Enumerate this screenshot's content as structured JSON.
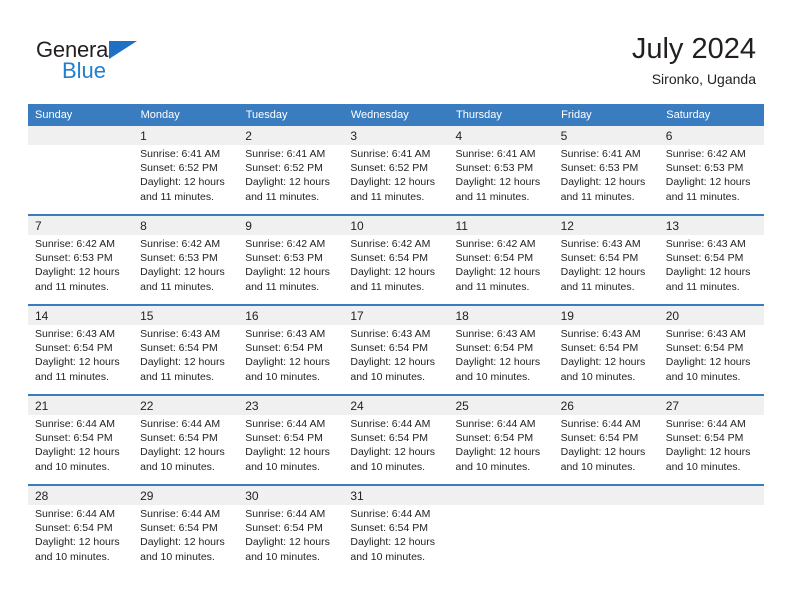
{
  "brand": {
    "name_part1": "General",
    "name_part2": "Blue",
    "accent_color": "#1f7fd0",
    "logo_triangle_color": "#1f6fc4"
  },
  "header": {
    "title": "July 2024",
    "subtitle": "Sironko, Uganda"
  },
  "theme": {
    "header_row_bg": "#3a7cc0",
    "header_row_text": "#ffffff",
    "daynum_row_bg": "#f0f0f0",
    "cell_text": "#231f20",
    "week_divider": "#3a7cc0"
  },
  "weekdays": [
    "Sunday",
    "Monday",
    "Tuesday",
    "Wednesday",
    "Thursday",
    "Friday",
    "Saturday"
  ],
  "weeks": [
    {
      "days": [
        {
          "num": "",
          "sunrise": "",
          "sunset": "",
          "daylight1": "",
          "daylight2": ""
        },
        {
          "num": "1",
          "sunrise": "Sunrise: 6:41 AM",
          "sunset": "Sunset: 6:52 PM",
          "daylight1": "Daylight: 12 hours",
          "daylight2": "and 11 minutes."
        },
        {
          "num": "2",
          "sunrise": "Sunrise: 6:41 AM",
          "sunset": "Sunset: 6:52 PM",
          "daylight1": "Daylight: 12 hours",
          "daylight2": "and 11 minutes."
        },
        {
          "num": "3",
          "sunrise": "Sunrise: 6:41 AM",
          "sunset": "Sunset: 6:52 PM",
          "daylight1": "Daylight: 12 hours",
          "daylight2": "and 11 minutes."
        },
        {
          "num": "4",
          "sunrise": "Sunrise: 6:41 AM",
          "sunset": "Sunset: 6:53 PM",
          "daylight1": "Daylight: 12 hours",
          "daylight2": "and 11 minutes."
        },
        {
          "num": "5",
          "sunrise": "Sunrise: 6:41 AM",
          "sunset": "Sunset: 6:53 PM",
          "daylight1": "Daylight: 12 hours",
          "daylight2": "and 11 minutes."
        },
        {
          "num": "6",
          "sunrise": "Sunrise: 6:42 AM",
          "sunset": "Sunset: 6:53 PM",
          "daylight1": "Daylight: 12 hours",
          "daylight2": "and 11 minutes."
        }
      ]
    },
    {
      "days": [
        {
          "num": "7",
          "sunrise": "Sunrise: 6:42 AM",
          "sunset": "Sunset: 6:53 PM",
          "daylight1": "Daylight: 12 hours",
          "daylight2": "and 11 minutes."
        },
        {
          "num": "8",
          "sunrise": "Sunrise: 6:42 AM",
          "sunset": "Sunset: 6:53 PM",
          "daylight1": "Daylight: 12 hours",
          "daylight2": "and 11 minutes."
        },
        {
          "num": "9",
          "sunrise": "Sunrise: 6:42 AM",
          "sunset": "Sunset: 6:53 PM",
          "daylight1": "Daylight: 12 hours",
          "daylight2": "and 11 minutes."
        },
        {
          "num": "10",
          "sunrise": "Sunrise: 6:42 AM",
          "sunset": "Sunset: 6:54 PM",
          "daylight1": "Daylight: 12 hours",
          "daylight2": "and 11 minutes."
        },
        {
          "num": "11",
          "sunrise": "Sunrise: 6:42 AM",
          "sunset": "Sunset: 6:54 PM",
          "daylight1": "Daylight: 12 hours",
          "daylight2": "and 11 minutes."
        },
        {
          "num": "12",
          "sunrise": "Sunrise: 6:43 AM",
          "sunset": "Sunset: 6:54 PM",
          "daylight1": "Daylight: 12 hours",
          "daylight2": "and 11 minutes."
        },
        {
          "num": "13",
          "sunrise": "Sunrise: 6:43 AM",
          "sunset": "Sunset: 6:54 PM",
          "daylight1": "Daylight: 12 hours",
          "daylight2": "and 11 minutes."
        }
      ]
    },
    {
      "days": [
        {
          "num": "14",
          "sunrise": "Sunrise: 6:43 AM",
          "sunset": "Sunset: 6:54 PM",
          "daylight1": "Daylight: 12 hours",
          "daylight2": "and 11 minutes."
        },
        {
          "num": "15",
          "sunrise": "Sunrise: 6:43 AM",
          "sunset": "Sunset: 6:54 PM",
          "daylight1": "Daylight: 12 hours",
          "daylight2": "and 11 minutes."
        },
        {
          "num": "16",
          "sunrise": "Sunrise: 6:43 AM",
          "sunset": "Sunset: 6:54 PM",
          "daylight1": "Daylight: 12 hours",
          "daylight2": "and 10 minutes."
        },
        {
          "num": "17",
          "sunrise": "Sunrise: 6:43 AM",
          "sunset": "Sunset: 6:54 PM",
          "daylight1": "Daylight: 12 hours",
          "daylight2": "and 10 minutes."
        },
        {
          "num": "18",
          "sunrise": "Sunrise: 6:43 AM",
          "sunset": "Sunset: 6:54 PM",
          "daylight1": "Daylight: 12 hours",
          "daylight2": "and 10 minutes."
        },
        {
          "num": "19",
          "sunrise": "Sunrise: 6:43 AM",
          "sunset": "Sunset: 6:54 PM",
          "daylight1": "Daylight: 12 hours",
          "daylight2": "and 10 minutes."
        },
        {
          "num": "20",
          "sunrise": "Sunrise: 6:43 AM",
          "sunset": "Sunset: 6:54 PM",
          "daylight1": "Daylight: 12 hours",
          "daylight2": "and 10 minutes."
        }
      ]
    },
    {
      "days": [
        {
          "num": "21",
          "sunrise": "Sunrise: 6:44 AM",
          "sunset": "Sunset: 6:54 PM",
          "daylight1": "Daylight: 12 hours",
          "daylight2": "and 10 minutes."
        },
        {
          "num": "22",
          "sunrise": "Sunrise: 6:44 AM",
          "sunset": "Sunset: 6:54 PM",
          "daylight1": "Daylight: 12 hours",
          "daylight2": "and 10 minutes."
        },
        {
          "num": "23",
          "sunrise": "Sunrise: 6:44 AM",
          "sunset": "Sunset: 6:54 PM",
          "daylight1": "Daylight: 12 hours",
          "daylight2": "and 10 minutes."
        },
        {
          "num": "24",
          "sunrise": "Sunrise: 6:44 AM",
          "sunset": "Sunset: 6:54 PM",
          "daylight1": "Daylight: 12 hours",
          "daylight2": "and 10 minutes."
        },
        {
          "num": "25",
          "sunrise": "Sunrise: 6:44 AM",
          "sunset": "Sunset: 6:54 PM",
          "daylight1": "Daylight: 12 hours",
          "daylight2": "and 10 minutes."
        },
        {
          "num": "26",
          "sunrise": "Sunrise: 6:44 AM",
          "sunset": "Sunset: 6:54 PM",
          "daylight1": "Daylight: 12 hours",
          "daylight2": "and 10 minutes."
        },
        {
          "num": "27",
          "sunrise": "Sunrise: 6:44 AM",
          "sunset": "Sunset: 6:54 PM",
          "daylight1": "Daylight: 12 hours",
          "daylight2": "and 10 minutes."
        }
      ]
    },
    {
      "days": [
        {
          "num": "28",
          "sunrise": "Sunrise: 6:44 AM",
          "sunset": "Sunset: 6:54 PM",
          "daylight1": "Daylight: 12 hours",
          "daylight2": "and 10 minutes."
        },
        {
          "num": "29",
          "sunrise": "Sunrise: 6:44 AM",
          "sunset": "Sunset: 6:54 PM",
          "daylight1": "Daylight: 12 hours",
          "daylight2": "and 10 minutes."
        },
        {
          "num": "30",
          "sunrise": "Sunrise: 6:44 AM",
          "sunset": "Sunset: 6:54 PM",
          "daylight1": "Daylight: 12 hours",
          "daylight2": "and 10 minutes."
        },
        {
          "num": "31",
          "sunrise": "Sunrise: 6:44 AM",
          "sunset": "Sunset: 6:54 PM",
          "daylight1": "Daylight: 12 hours",
          "daylight2": "and 10 minutes."
        },
        {
          "num": "",
          "sunrise": "",
          "sunset": "",
          "daylight1": "",
          "daylight2": ""
        },
        {
          "num": "",
          "sunrise": "",
          "sunset": "",
          "daylight1": "",
          "daylight2": ""
        },
        {
          "num": "",
          "sunrise": "",
          "sunset": "",
          "daylight1": "",
          "daylight2": ""
        }
      ]
    }
  ]
}
